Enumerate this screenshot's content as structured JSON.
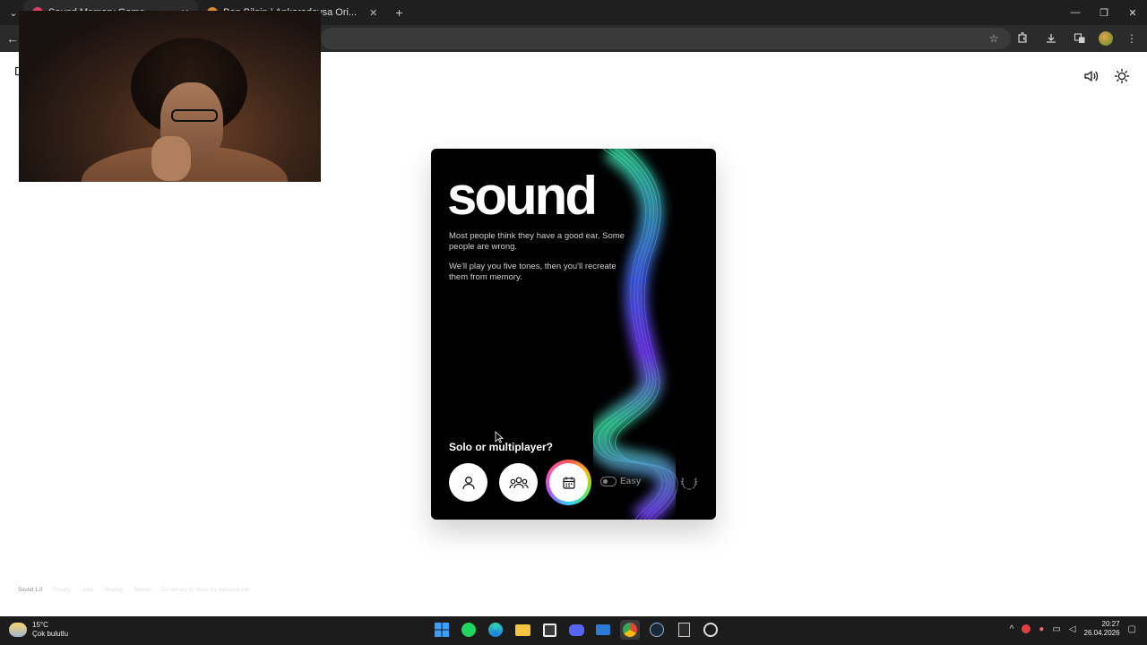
{
  "browser": {
    "tabs": [
      {
        "title": "Sound Memory Game — ...",
        "active": true
      },
      {
        "title": "Ben Bilgin | Ankaradaysa Ori...",
        "active": false
      }
    ],
    "window_controls": [
      "—",
      "❐",
      "✕"
    ]
  },
  "page": {
    "left_char": "D",
    "card": {
      "title": "sound",
      "paragraph1": "Most people think they have a good ear. Some people are wrong.",
      "paragraph2": "We'll play you five tones, then you'll recreate them from memory.",
      "question": "Solo or multiplayer?",
      "difficulty_label": "Easy",
      "difficulty_on": false
    },
    "footer": {
      "version": "Sound 1.0",
      "links": [
        "Privacy",
        "Judo",
        "Sharing",
        "Stacelo",
        "Do not sell or share my personal info"
      ]
    }
  },
  "taskbar": {
    "temp": "15°C",
    "condition": "Çok bulutlu",
    "time": "20:27",
    "date": "26.04.2026"
  },
  "colors": {
    "card_bg": "#000000",
    "wave_green": "#37e0a0",
    "wave_purple": "#7a3cff"
  }
}
